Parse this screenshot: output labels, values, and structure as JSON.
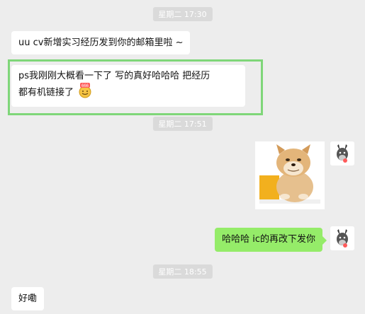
{
  "timestamps": [
    "星期二 17:30",
    "星期二 17:51",
    "星期二 18:55"
  ],
  "messages": {
    "m1": "uu cv新增实习经历发到你的邮箱里啦 ~",
    "m2_line1": "ps我刚刚大概看一下了 写的真好哈哈哈 把经历",
    "m2_line2": "都有机链接了",
    "m4": "哈哈哈 ic的再改下发你",
    "m5": "好嘞"
  },
  "emoji_badge": "666",
  "colors": {
    "background": "#ededed",
    "bubble_left": "#ffffff",
    "bubble_right": "#95ec69",
    "highlight_border": "#7fd679",
    "timestamp_bg": "#dadada"
  },
  "icons": {
    "avatar": "donkey-avatar-icon",
    "emoji": "666-thumbs-emoji-icon",
    "sticker": "doge-sticker-icon"
  }
}
